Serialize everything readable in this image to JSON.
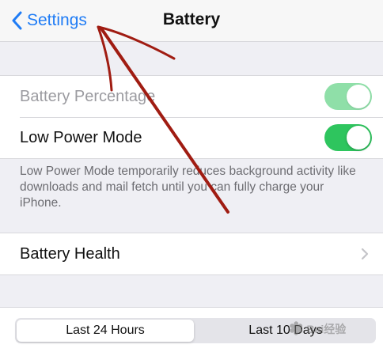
{
  "navbar": {
    "back_label": "Settings",
    "back_icon": "chevron-left-icon",
    "title": "Battery"
  },
  "settings": {
    "battery_percentage": {
      "label": "Battery Percentage",
      "enabled": true,
      "on": true
    },
    "low_power_mode": {
      "label": "Low Power Mode",
      "on": true
    },
    "low_power_footer": "Low Power Mode temporarily reduces background activity like downloads and mail fetch until you can fully charge your iPhone.",
    "battery_health": {
      "label": "Battery Health",
      "icon": "chevron-right-icon"
    }
  },
  "segmented": {
    "options": [
      "Last 24 Hours",
      "Last 10 Days"
    ],
    "selected": "Last 24 Hours"
  },
  "watermark": {
    "text": "Bai经验",
    "mark": "du"
  },
  "colors": {
    "accent": "#1f7cf5",
    "toggle_on": "#2ec55e",
    "background": "#efeff4",
    "annotation_arrow": "#a01c12"
  }
}
